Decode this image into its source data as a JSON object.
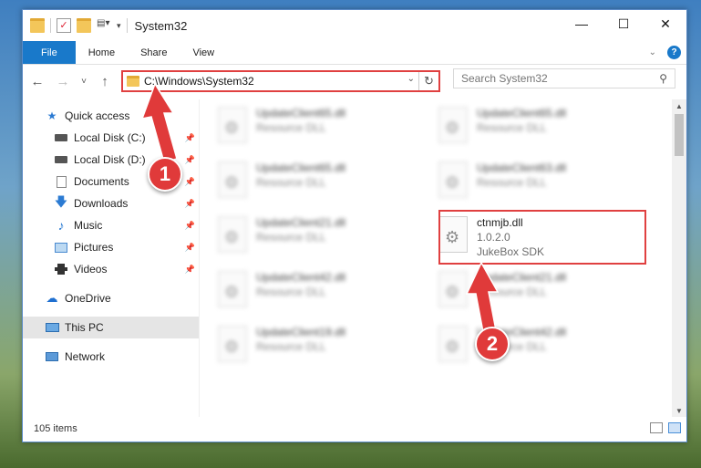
{
  "window": {
    "title": "System32"
  },
  "ribbon": {
    "tabs": [
      "File",
      "Home",
      "Share",
      "View"
    ],
    "help": "?"
  },
  "nav": {
    "back": "←",
    "forward": "→",
    "recent": "˅",
    "up": "↑",
    "address": "C:\\Windows\\System32",
    "refresh": "↻",
    "search_placeholder": "Search System32"
  },
  "sidebar": {
    "items": [
      {
        "label": "Quick access",
        "icon": "star-icon"
      },
      {
        "label": "Local Disk (C:)",
        "icon": "drive-icon"
      },
      {
        "label": "Local Disk (D:)",
        "icon": "drive-icon"
      },
      {
        "label": "Documents",
        "icon": "documents-icon"
      },
      {
        "label": "Downloads",
        "icon": "downloads-icon"
      },
      {
        "label": "Music",
        "icon": "music-icon"
      },
      {
        "label": "Pictures",
        "icon": "pictures-icon"
      },
      {
        "label": "Videos",
        "icon": "videos-icon"
      },
      {
        "label": "OneDrive",
        "icon": "onedrive-icon"
      },
      {
        "label": "This PC",
        "icon": "pc-icon"
      },
      {
        "label": "Network",
        "icon": "network-icon"
      }
    ]
  },
  "files": [
    {
      "name": "UpdateClient65.dll",
      "line2": "Resource DLL"
    },
    {
      "name": "UpdateClient65.dll",
      "line2": "Resource DLL"
    },
    {
      "name": "UpdateClient65.dll",
      "line2": "Resource DLL"
    },
    {
      "name": "UpdateClient63.dll",
      "line2": "Resource DLL"
    },
    {
      "name": "UpdateClient21.dll",
      "line2": "Resource DLL"
    },
    {
      "name": "ctnmjb.dll",
      "line2": "1.0.2.0",
      "line3": "JukeBox SDK"
    },
    {
      "name": "UpdateClient42.dll",
      "line2": "Resource DLL"
    },
    {
      "name": "UpdateClient21.dll",
      "line2": "Resource DLL"
    },
    {
      "name": "UpdateClient19.dll",
      "line2": "Resource DLL"
    },
    {
      "name": "UpdateClient42.dll",
      "line2": "Resource DLL"
    }
  ],
  "status": {
    "count": "105 items"
  },
  "annotations": {
    "badge1": "1",
    "badge2": "2"
  },
  "colors": {
    "accent": "#1979ca",
    "highlight": "#e04040"
  }
}
